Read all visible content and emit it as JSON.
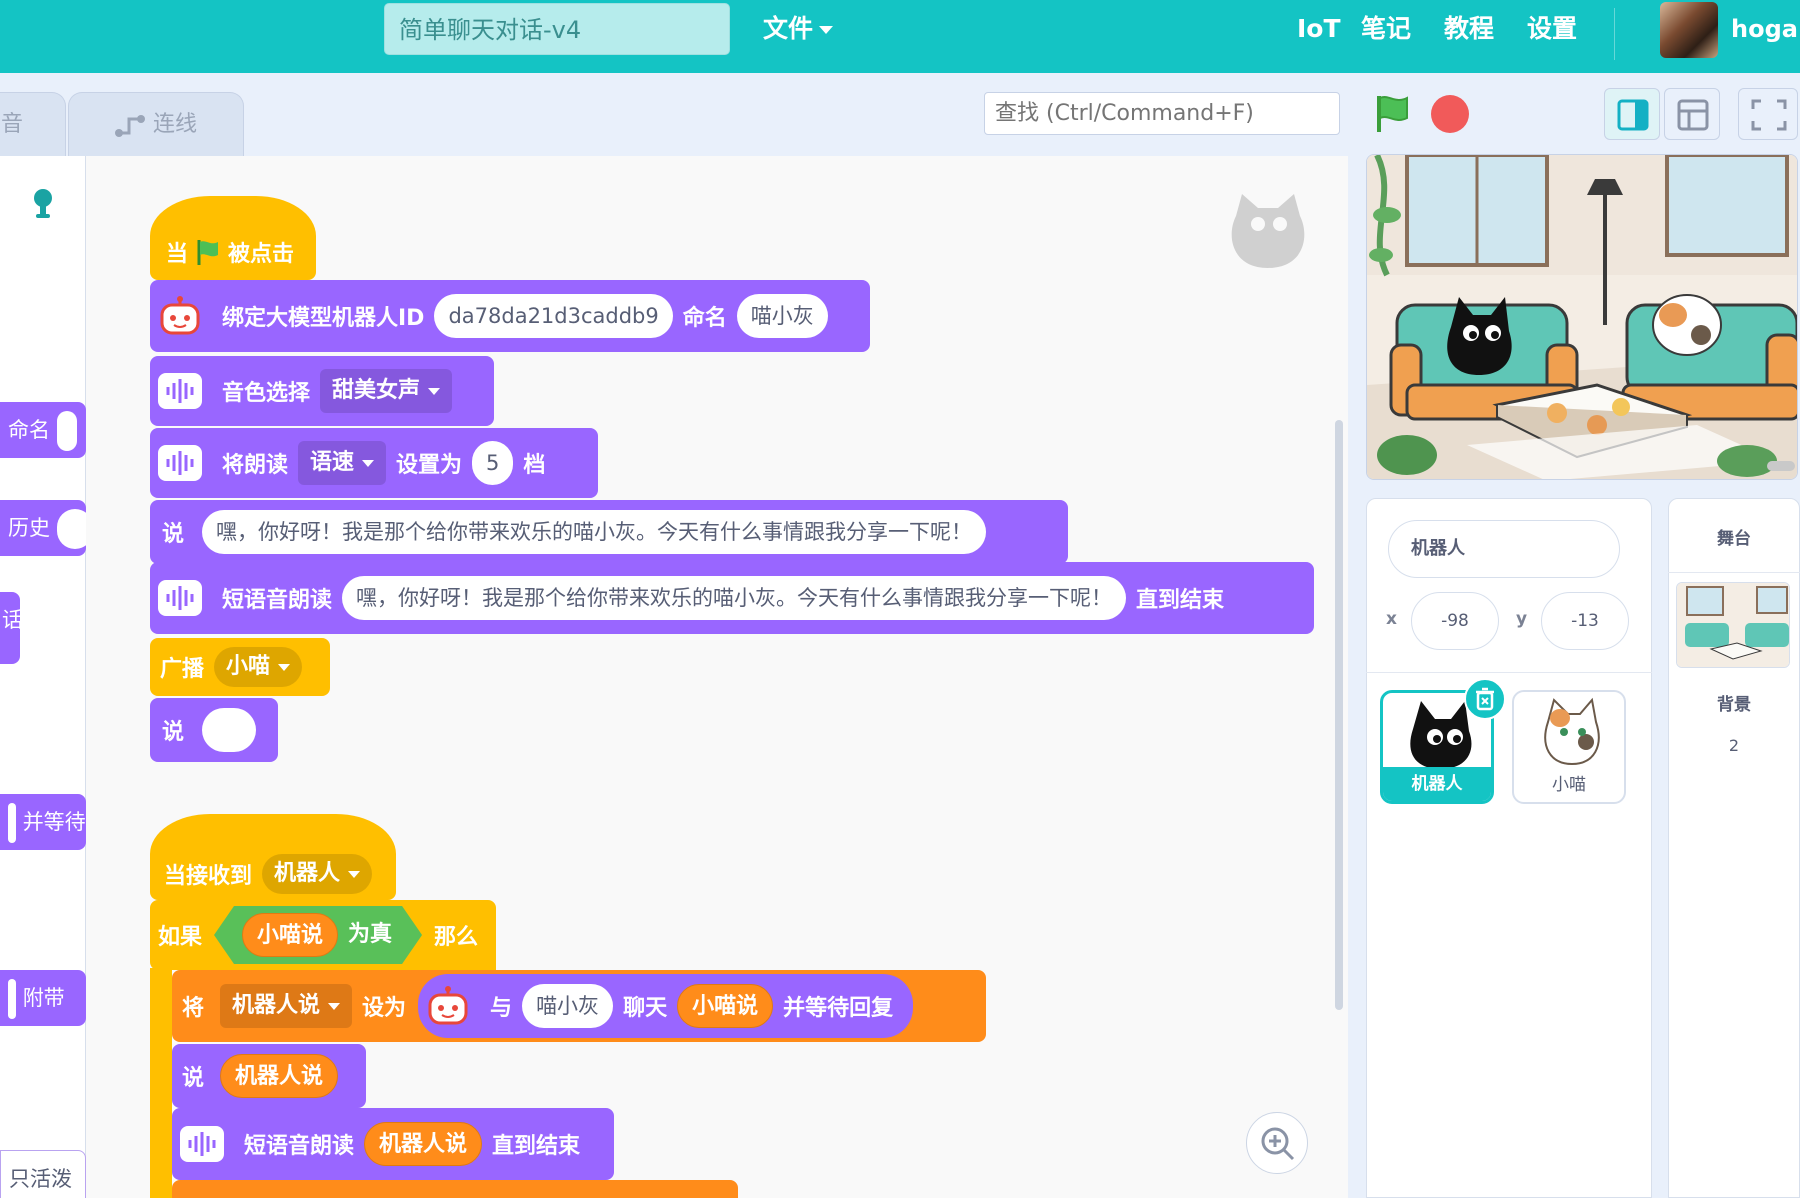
{
  "header": {
    "project_title": "简单聊天对话-v4",
    "file_menu": "文件",
    "nav": [
      "IoT",
      "笔记",
      "教程",
      "设置"
    ],
    "username": "hogan"
  },
  "tabs": {
    "sound": "音",
    "connect": "连线"
  },
  "search": {
    "placeholder": "查找 (Ctrl/Command+F)"
  },
  "palette": {
    "items": [
      "命名",
      "历史",
      "话",
      "并等待",
      "附带",
      "只活泼"
    ]
  },
  "script1": {
    "hat_when": "当",
    "hat_clicked": "被点击",
    "bind_label": "绑定大模型机器人ID",
    "bind_id": "da78da21d3caddb9",
    "bind_name_label": "命名",
    "bind_name": "喵小灰",
    "voice_label": "音色选择",
    "voice_value": "甜美女声",
    "rate_label": "将朗读",
    "rate_param": "语速",
    "rate_set": "设置为",
    "rate_value": "5",
    "rate_unit": "档",
    "say_label": "说",
    "say_text": "嘿，你好呀！我是那个给你带来欢乐的喵小灰。今天有什么事情跟我分享一下呢！",
    "speak_label": "短语音朗读",
    "speak_text": "嘿，你好呀！我是那个给你带来欢乐的喵小灰。今天有什么事情跟我分享一下呢！",
    "speak_until": "直到结束",
    "broadcast_label": "广播",
    "broadcast_value": "小喵",
    "say2_label": "说",
    "say2_text": ""
  },
  "script2": {
    "hat_label": "当接收到",
    "hat_value": "机器人",
    "if_label": "如果",
    "if_var": "小喵说",
    "if_true": "为真",
    "if_then": "那么",
    "set_label": "将",
    "set_var": "机器人说",
    "set_to": "设为",
    "with_label": "与",
    "with_name": "喵小灰",
    "chat_label": "聊天",
    "chat_var": "小喵说",
    "chat_wait": "并等待回复",
    "say_label": "说",
    "say_var": "机器人说",
    "speak_label": "短语音朗读",
    "speak_var": "机器人说",
    "speak_until": "直到结束"
  },
  "sprite_info": {
    "name": "机器人",
    "x_label": "x",
    "x": "-98",
    "y_label": "y",
    "y": "-13"
  },
  "sprites": [
    {
      "name": "机器人",
      "selected": true
    },
    {
      "name": "小喵",
      "selected": false
    }
  ],
  "stage_panel": {
    "title": "舞台",
    "backdrop_label": "背景",
    "backdrop_count": "2"
  },
  "colors": {
    "topbar": "#14c4c4",
    "looks_purple": "#9966ff",
    "events_yellow": "#ffbf00",
    "variables_orange": "#ff8c1a",
    "operators_green": "#59c059"
  }
}
